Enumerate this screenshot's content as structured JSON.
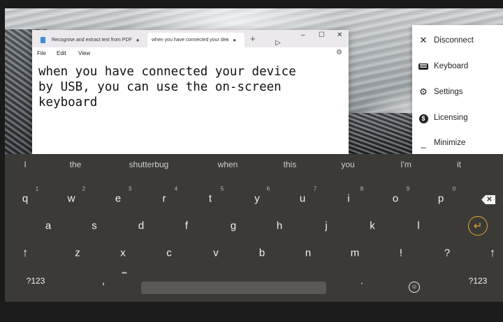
{
  "notepad": {
    "tabs": [
      {
        "label": "Recognise and extract text from PDF",
        "unsaved_marker": "●"
      },
      {
        "label": "when you have connected your deв",
        "unsaved_marker": "●"
      }
    ],
    "new_tab": "+",
    "window_buttons": {
      "minimize": "–",
      "maximize": "☐",
      "close": "✕"
    },
    "menu": [
      "File",
      "Edit",
      "View"
    ],
    "settings_icon": "⚙",
    "document_text": "when you have connected your device\nby USB, you can use the on-screen\nkeyboard"
  },
  "side_menu": {
    "items": [
      {
        "label": "Disconnect",
        "icon": "close-icon",
        "glyph": "✕"
      },
      {
        "label": "Keyboard",
        "icon": "keyboard-icon",
        "glyph": ""
      },
      {
        "label": "Settings",
        "icon": "gear-icon",
        "glyph": "⚙"
      },
      {
        "label": "Licensing",
        "icon": "dollar-icon",
        "glyph": "$"
      },
      {
        "label": "Minimize",
        "icon": "minimize-icon",
        "glyph": "_"
      }
    ]
  },
  "keyboard": {
    "suggestions": [
      "I",
      "the",
      "shutterbug",
      "when",
      "this",
      "you",
      "I'm",
      "it"
    ],
    "row1": [
      {
        "key": "q",
        "hint": "1"
      },
      {
        "key": "w",
        "hint": "2"
      },
      {
        "key": "e",
        "hint": "3"
      },
      {
        "key": "r",
        "hint": "4"
      },
      {
        "key": "t",
        "hint": "5"
      },
      {
        "key": "y",
        "hint": "6"
      },
      {
        "key": "u",
        "hint": "7"
      },
      {
        "key": "i",
        "hint": "8"
      },
      {
        "key": "o",
        "hint": "9"
      },
      {
        "key": "p",
        "hint": "0"
      }
    ],
    "row2": [
      "a",
      "s",
      "d",
      "f",
      "g",
      "h",
      "j",
      "k",
      "l"
    ],
    "row3": [
      "↑",
      "z",
      "x",
      "c",
      "v",
      "b",
      "n",
      "m",
      "!",
      "?",
      "↑"
    ],
    "row4": {
      "symbols_left": "?123",
      "comma": ",",
      "period": ".",
      "symbols_right": "?123"
    },
    "backspace": "✕",
    "enter": "↵",
    "emoji": "☺",
    "accent_color": "#e7a52a"
  }
}
